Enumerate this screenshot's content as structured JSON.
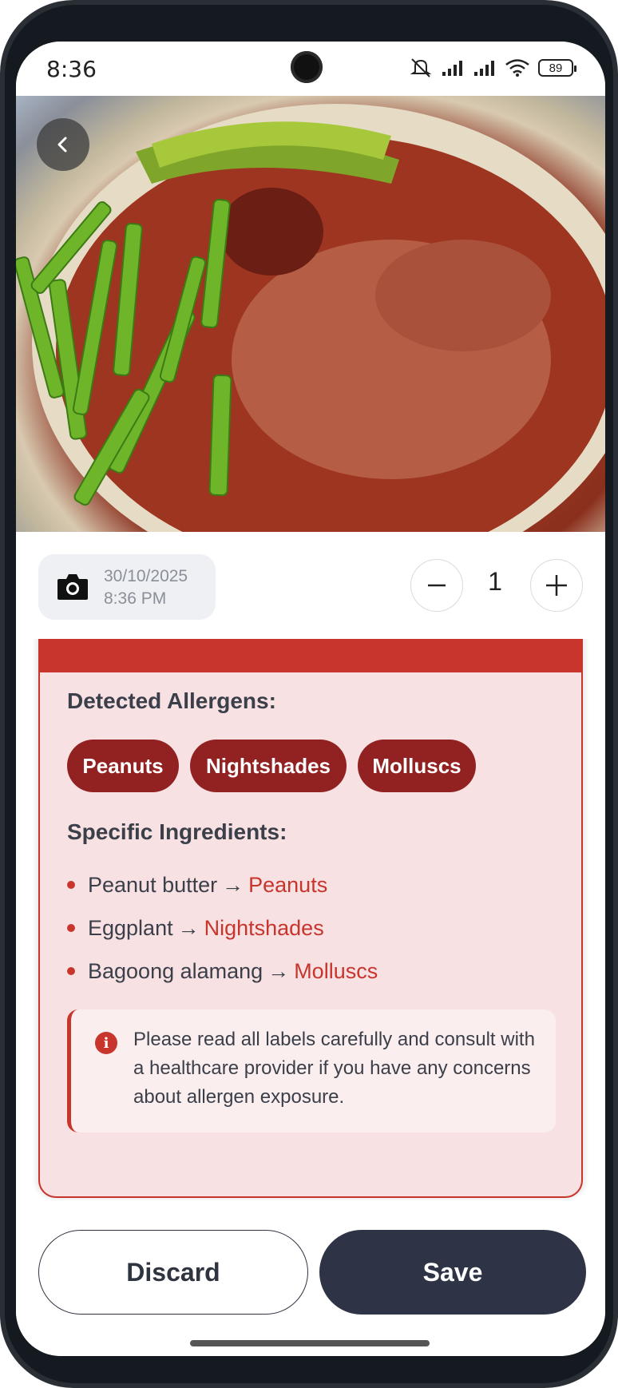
{
  "status_bar": {
    "time": "8:36",
    "battery": "89"
  },
  "meta": {
    "date": "30/10/2025",
    "time": "8:36 PM",
    "quantity": "1"
  },
  "allergens": {
    "detected_title": "Detected Allergens:",
    "pills": [
      "Peanuts",
      "Nightshades",
      "Molluscs"
    ],
    "specific_title": "Specific Ingredients:",
    "arrow": "→",
    "ingredients": [
      {
        "name": "Peanut butter",
        "allergen": "Peanuts"
      },
      {
        "name": "Eggplant",
        "allergen": "Nightshades"
      },
      {
        "name": "Bagoong alamang",
        "allergen": "Molluscs"
      }
    ],
    "notice": "Please read all labels carefully and consult with a healthcare provider if you have any concerns about allergen exposure."
  },
  "actions": {
    "discard": "Discard",
    "save": "Save"
  },
  "colors": {
    "accent": "#c8352d",
    "pill": "#922222",
    "card_bg": "#f7e1e2",
    "save_bg": "#2e3445"
  }
}
